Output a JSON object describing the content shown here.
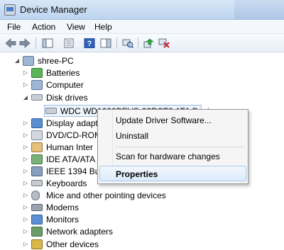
{
  "window": {
    "title": "Device Manager"
  },
  "menu": {
    "file": "File",
    "action": "Action",
    "view": "View",
    "help": "Help"
  },
  "toolbar": {
    "icons": [
      "back-arrow-icon",
      "forward-arrow-icon",
      "show-hide-console-tree-icon",
      "properties-icon",
      "help-icon",
      "action-pane-icon",
      "scan-hardware-icon",
      "update-driver-icon",
      "uninstall-device-icon"
    ]
  },
  "tree": {
    "root": "shree-PC",
    "batteries": "Batteries",
    "computer": "Computer",
    "disk_drives": "Disk drives",
    "disk_device": "WDC WD1600BEVS-22RST0 ATA Device",
    "display": "Display adapt",
    "dvd": "DVD/CD-ROM",
    "hid": "Human Inter",
    "ide": "IDE ATA/ATA",
    "ieee": "IEEE 1394 Bus",
    "keyboards": "Keyboards",
    "mice": "Mice and other pointing devices",
    "modems": "Modems",
    "monitors": "Monitors",
    "network": "Network adapters",
    "other": "Other devices"
  },
  "context_menu": {
    "update": "Update Driver Software...",
    "uninstall": "Uninstall",
    "scan": "Scan for hardware changes",
    "properties": "Properties"
  }
}
